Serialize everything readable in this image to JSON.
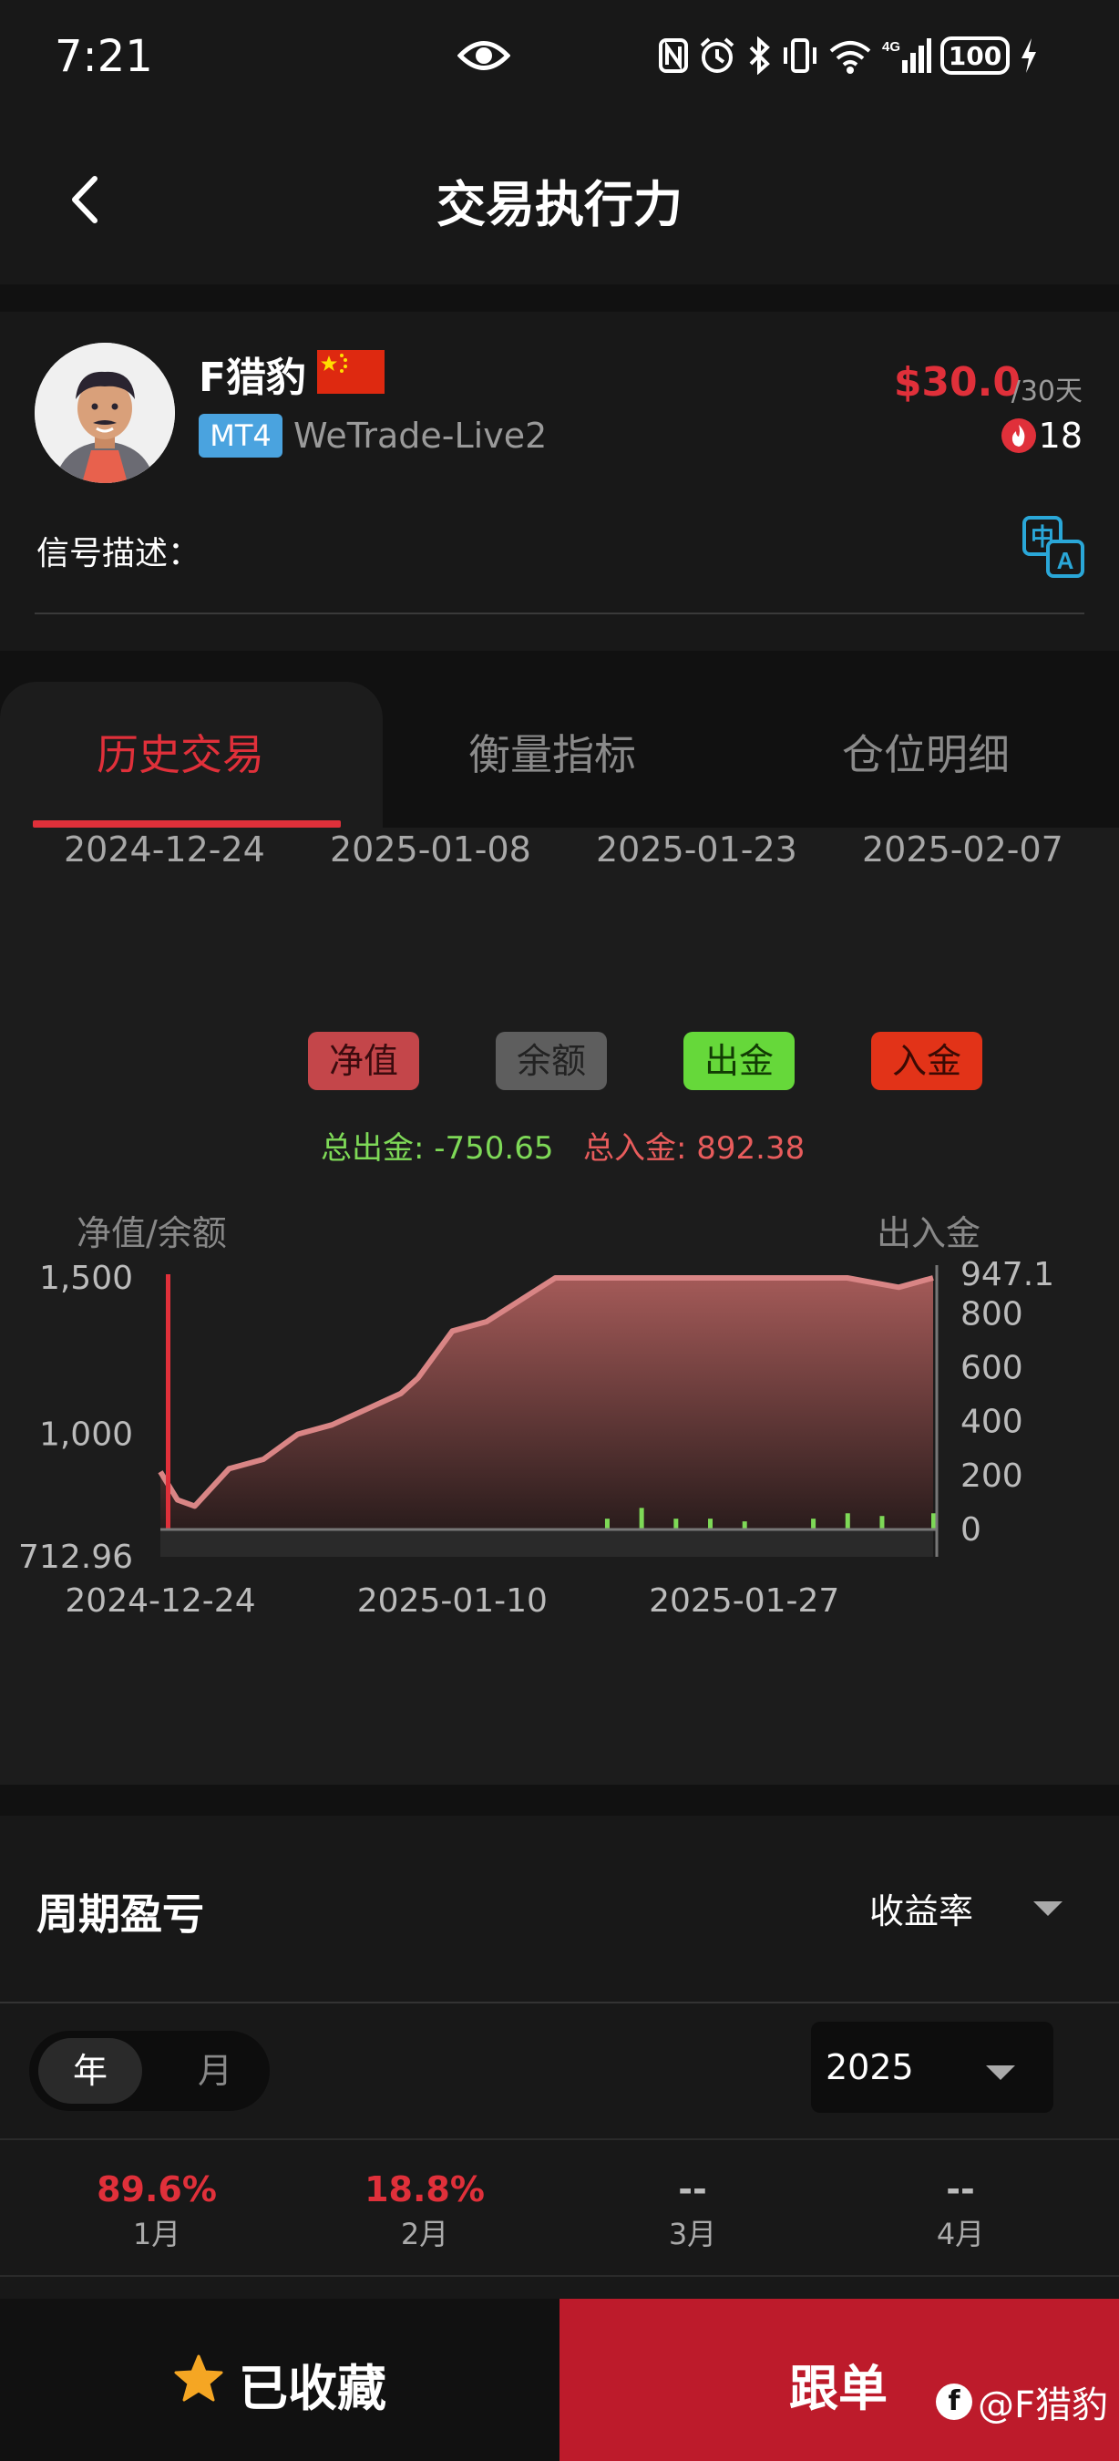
{
  "status_bar": {
    "time": "7:21",
    "battery": "100"
  },
  "header": {
    "title": "交易执行力"
  },
  "profile": {
    "name": "F猎豹",
    "platform": "MT4",
    "server": "WeTrade-Live2",
    "price": "$30.0",
    "period": "/30天",
    "followers": "18",
    "signal_desc_label": "信号描述："
  },
  "tabs": [
    {
      "label": "历史交易",
      "active": true
    },
    {
      "label": "衡量指标",
      "active": false
    },
    {
      "label": "仓位明细",
      "active": false
    }
  ],
  "top_dates": [
    "2024-12-24",
    "2025-01-08",
    "2025-01-23",
    "2025-02-07"
  ],
  "legend": [
    {
      "label": "净值",
      "bg": "#c4464a",
      "fg": "#3a0b0e"
    },
    {
      "label": "余额",
      "bg": "#5e5e5e",
      "fg": "#222222"
    },
    {
      "label": "出金",
      "bg": "#66d83a",
      "fg": "#123c04"
    },
    {
      "label": "入金",
      "bg": "#e23318",
      "fg": "#3b0a04"
    }
  ],
  "totals": {
    "withdraw": "总出金: -750.65",
    "deposit": "总入金: 892.38",
    "withdraw_color": "#7ed957",
    "deposit_color": "#e85c5c"
  },
  "axis": {
    "left_title": "净值/余额",
    "right_title": "出入金"
  },
  "chart_data": {
    "type": "area",
    "x": [
      "2024-12-24",
      "2024-12-25",
      "2024-12-26",
      "2024-12-28",
      "2024-12-30",
      "2025-01-01",
      "2025-01-03",
      "2025-01-05",
      "2025-01-07",
      "2025-01-08",
      "2025-01-10",
      "2025-01-12",
      "2025-01-14",
      "2025-01-16",
      "2025-01-18",
      "2025-01-20",
      "2025-01-22",
      "2025-01-24",
      "2025-01-27",
      "2025-01-30",
      "2025-02-02",
      "2025-02-05",
      "2025-02-07"
    ],
    "series": [
      {
        "name": "净值",
        "values": [
          880,
          790,
          770,
          890,
          920,
          1000,
          1030,
          1080,
          1130,
          1180,
          1330,
          1360,
          1430,
          1500,
          1500,
          1500,
          1500,
          1500,
          1500,
          1500,
          1500,
          1470,
          1500
        ]
      }
    ],
    "flows": {
      "x": [
        "2024-12-24",
        "2025-01-19",
        "2025-01-21",
        "2025-01-23",
        "2025-01-25",
        "2025-01-27",
        "2025-01-31",
        "2025-02-02",
        "2025-02-04",
        "2025-02-07"
      ],
      "values": [
        947.1,
        40,
        80,
        40,
        40,
        30,
        40,
        60,
        50,
        60
      ]
    },
    "y_left_ticks": [
      "1,500",
      "1,000",
      "712.96"
    ],
    "y_right_ticks": [
      "947.1",
      "800",
      "600",
      "400",
      "200",
      "0"
    ],
    "x_ticks": [
      "2024-12-24",
      "2025-01-10",
      "2025-01-27"
    ],
    "ylim_left": [
      712.96,
      1500
    ],
    "ylim_right": [
      0,
      947.1
    ]
  },
  "period_section": {
    "title": "周期盈亏",
    "metric": "收益率",
    "toggle": {
      "year": "年",
      "month": "月"
    },
    "year": "2025",
    "months": [
      {
        "value": "89.6%",
        "name": "1月",
        "positive": true
      },
      {
        "value": "18.8%",
        "name": "2月",
        "positive": true
      },
      {
        "value": "--",
        "name": "3月",
        "positive": false
      },
      {
        "value": "--",
        "name": "4月",
        "positive": false
      }
    ]
  },
  "bottom": {
    "favorite": "已收藏",
    "follow": "跟单",
    "watermark": "@F猎豹"
  }
}
